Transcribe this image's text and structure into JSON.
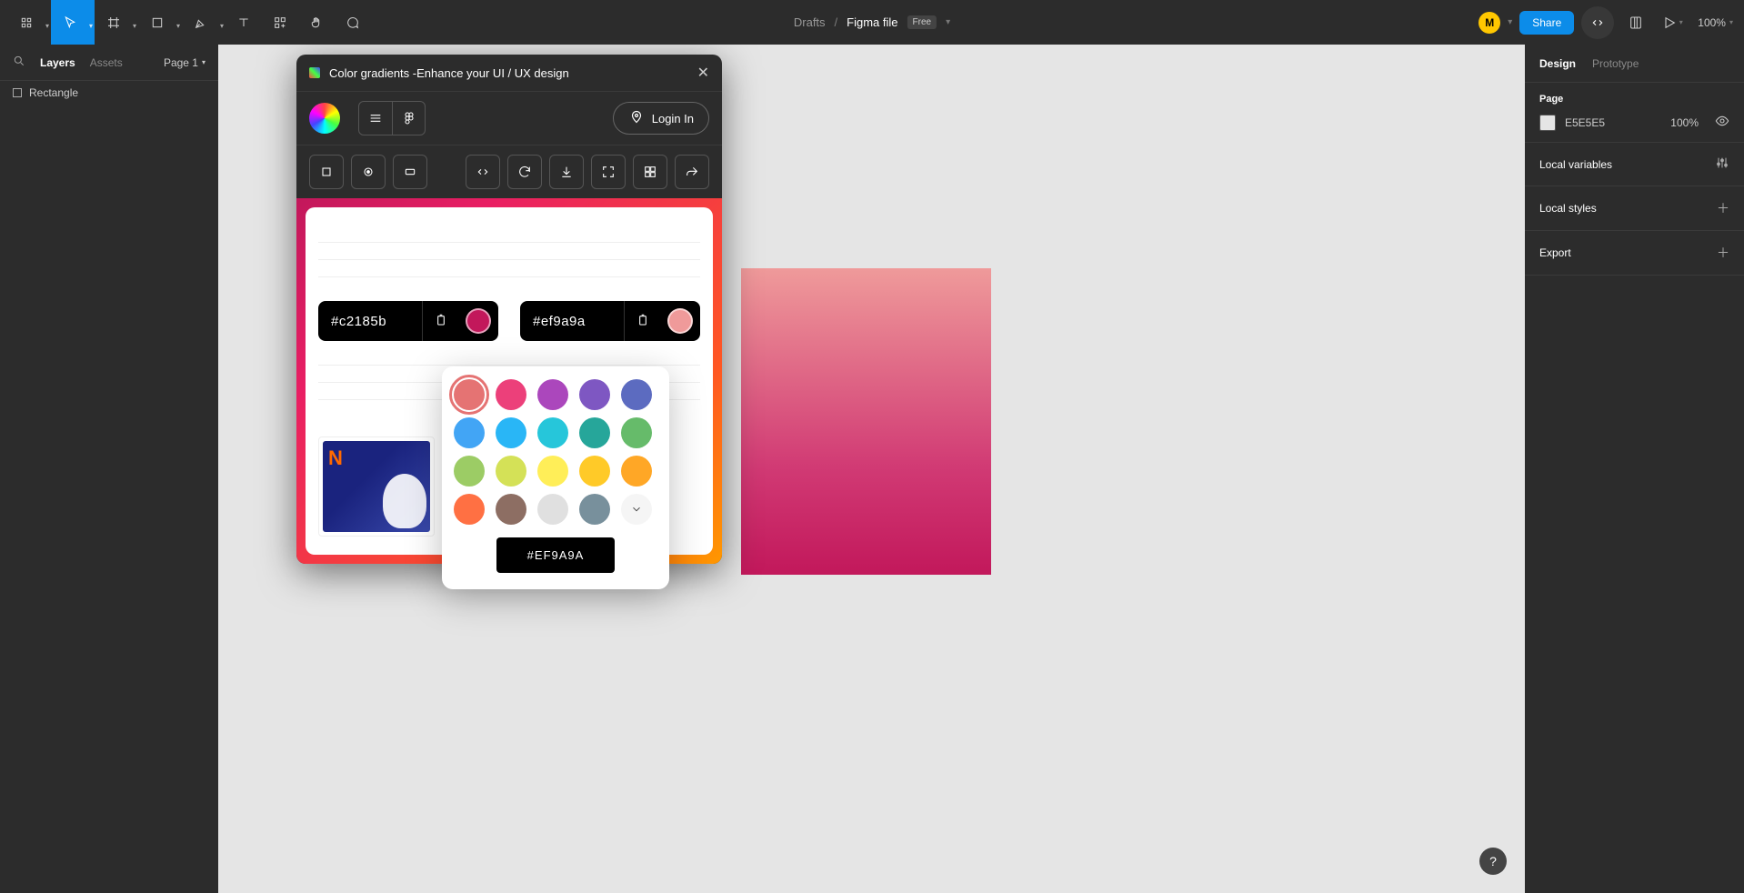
{
  "topbar": {
    "breadcrumb_parent": "Drafts",
    "breadcrumb_file": "Figma file",
    "badge": "Free",
    "avatar_initial": "M",
    "share_label": "Share",
    "zoom": "100%"
  },
  "left": {
    "tab_layers": "Layers",
    "tab_assets": "Assets",
    "page_picker": "Page 1",
    "layers": [
      {
        "name": "Rectangle"
      }
    ]
  },
  "right": {
    "tab_design": "Design",
    "tab_prototype": "Prototype",
    "section_page": "Page",
    "page_color": "E5E5E5",
    "page_opacity": "100%",
    "local_variables": "Local variables",
    "local_styles": "Local styles",
    "export": "Export"
  },
  "plugin": {
    "title": "Color gradients -Enhance your UI / UX design",
    "login": "Login In",
    "hex1": "#c2185b",
    "hex2": "#ef9a9a"
  },
  "popover": {
    "swatches": [
      "#e57373",
      "#ec407a",
      "#ab47bc",
      "#7e57c2",
      "#5c6bc0",
      "#42a5f5",
      "#29b6f6",
      "#26c6da",
      "#26a69a",
      "#66bb6a",
      "#9ccc65",
      "#d4e157",
      "#ffee58",
      "#ffca28",
      "#ffa726",
      "#ff7043",
      "#8d6e63",
      "#e0e0e0",
      "#78909c"
    ],
    "selected_hex": "#EF9A9A"
  }
}
